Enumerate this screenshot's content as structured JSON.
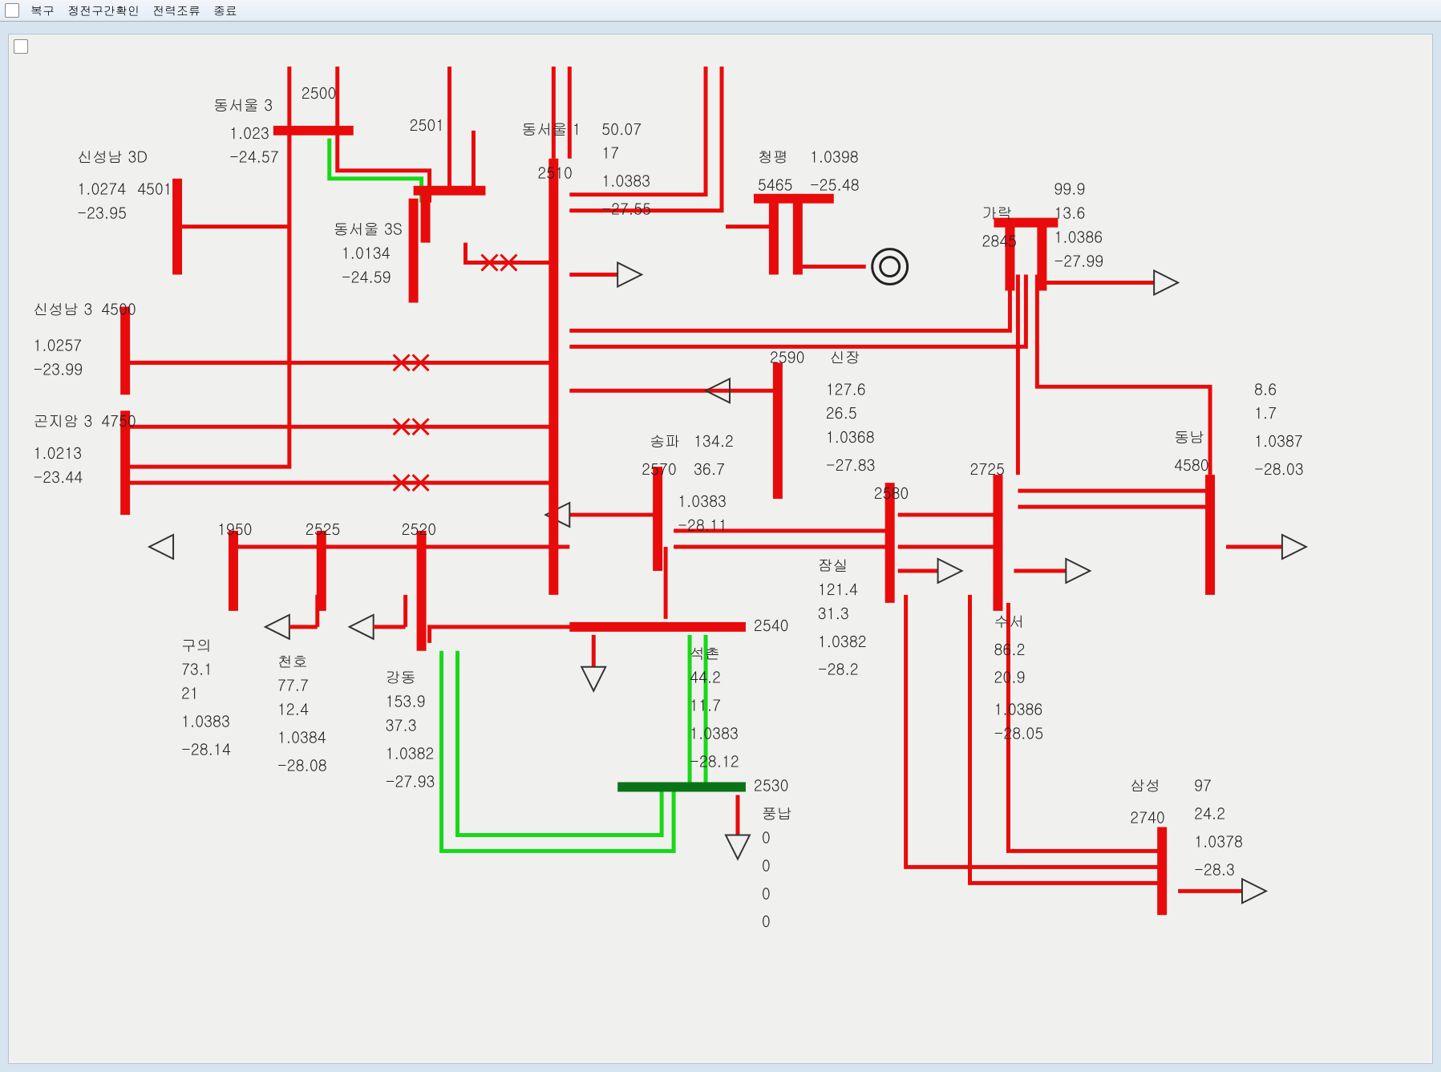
{
  "menu": {
    "m0": "복구",
    "m1": "정전구간확인",
    "m2": "전력조류",
    "m3": "종료"
  },
  "bus": {
    "sinseongnam3d": {
      "name": "신성남 3D",
      "id": "",
      "v": "1.0274",
      "a": "-23.95"
    },
    "b4501": {
      "id": "4501"
    },
    "sinseongnam3": {
      "name": "신성남 3",
      "id": "4500",
      "v": "1.0257",
      "a": "-23.99"
    },
    "gonjiam3": {
      "name": "곤지암 3",
      "id": "4750",
      "v": "1.0213",
      "a": "-23.44"
    },
    "dongseoul3": {
      "name": "동서울 3",
      "id": "2500",
      "v": "1.023",
      "a": "-24.57"
    },
    "dongseoul3s": {
      "name": "동서울 3S",
      "id": "2501",
      "v": "1.0134",
      "a": "-24.59"
    },
    "dongseoul1": {
      "name": "동서울 1",
      "id": "2510",
      "p": "50.07",
      "q": "17",
      "v": "1.0383",
      "a": "-27.55"
    },
    "cheongpyeong": {
      "name": "청평",
      "id": "5465",
      "v": "1.0398",
      "a": "-25.48"
    },
    "garak": {
      "name": "가락",
      "id": "2845",
      "p": "99.9",
      "q": "13.6",
      "v": "1.0386",
      "a": "-27.99"
    },
    "sinjang": {
      "name": "신장",
      "id": "2590",
      "p": "127.6",
      "q": "26.5",
      "v": "1.0368",
      "a": "-27.83"
    },
    "songpa": {
      "name": "송파",
      "id": "2570",
      "p": "134.2",
      "q": "36.7",
      "v": "1.0383",
      "a": "-28.11"
    },
    "jamsil": {
      "name": "잠실",
      "id": "2580",
      "p": "121.4",
      "q": "31.3",
      "v": "1.0382",
      "a": "-28.2"
    },
    "b2725": {
      "id": "2725"
    },
    "dongnam": {
      "name": "동남",
      "id": "4580",
      "p": "8.6",
      "q": "1.7",
      "v": "1.0387",
      "a": "-28.03"
    },
    "guui": {
      "name": "구의",
      "id": "1950",
      "p": "73.1",
      "q": "21",
      "v": "1.0383",
      "a": "-28.14"
    },
    "cheonho": {
      "name": "천호",
      "id": "2525",
      "p": "77.7",
      "q": "12.4",
      "v": "1.0384",
      "a": "-28.08"
    },
    "gangdong": {
      "name": "강동",
      "id": "2520",
      "p": "153.9",
      "q": "37.3",
      "v": "1.0382",
      "a": "-27.93"
    },
    "seokchon": {
      "name": "석촌",
      "id": "2540",
      "p": "44.2",
      "q": "11.7",
      "v": "1.0383",
      "a": "-28.12"
    },
    "pungnap": {
      "name": "풍납",
      "id": "2530",
      "p": "0",
      "q": "0",
      "v": "0",
      "a": "0"
    },
    "suseo": {
      "name": "수서",
      "id": "",
      "p": "86.2",
      "q": "20.9",
      "v": "1.0386",
      "a": "-28.05"
    },
    "samseong": {
      "name": "삼성",
      "id": "2740",
      "p": "97",
      "q": "24.2",
      "v": "1.0378",
      "a": "-28.3"
    }
  }
}
